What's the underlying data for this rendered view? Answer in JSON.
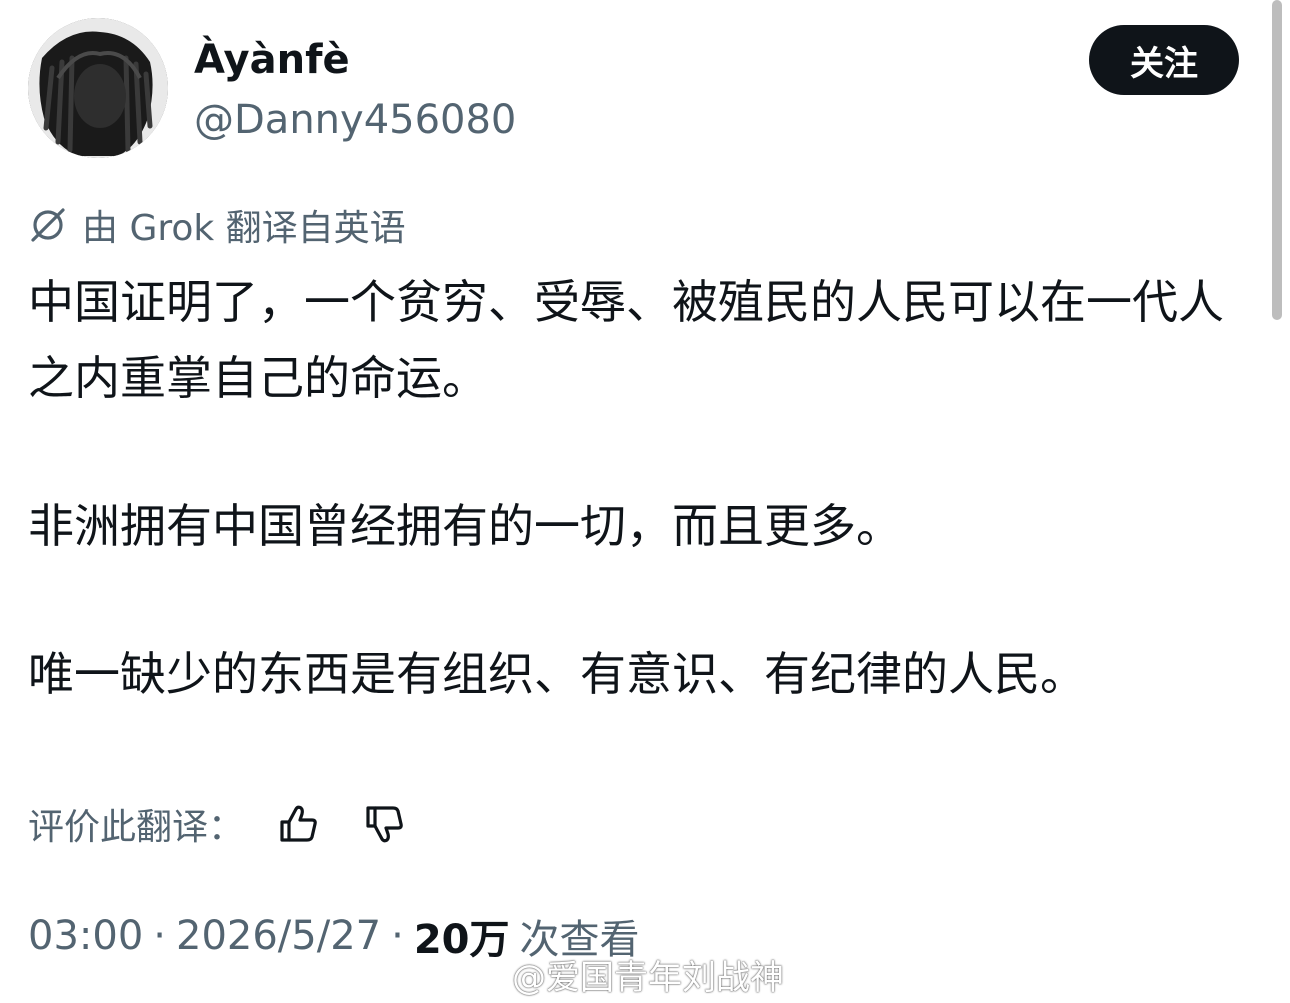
{
  "author": {
    "display_name": "Àyànfè",
    "handle": "@Danny456080"
  },
  "follow_button": {
    "label": "关注"
  },
  "translation": {
    "note": "由 Grok 翻译自英语",
    "icon": "grok-icon"
  },
  "tweet": {
    "paragraphs": [
      "中国证明了，一个贫穷、受辱、被殖民的人民可以在一代人之内重掌自己的命运。",
      "非洲拥有中国曾经拥有的一切，而且更多。",
      "唯一缺少的东西是有组织、有意识、有纪律的人民。"
    ]
  },
  "rate_translation": {
    "label": "评价此翻译：",
    "thumbs_up_icon": "thumbs-up-icon",
    "thumbs_down_icon": "thumbs-down-icon"
  },
  "meta": {
    "time": "03:00",
    "separator": "·",
    "date": "2026/5/27",
    "views_count": "20万",
    "views_label": "次查看"
  },
  "watermark": {
    "text": "@爱国青年刘战神"
  },
  "colors": {
    "text_primary": "#0f1419",
    "text_secondary": "#536471",
    "button_bg": "#0f1419",
    "button_text": "#ffffff"
  }
}
